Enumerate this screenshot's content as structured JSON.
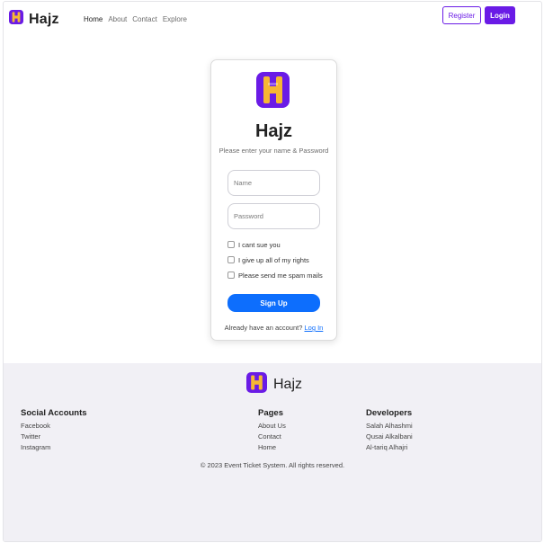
{
  "brand": {
    "name": "Hajz",
    "logo_icon": "hajz-logo-icon",
    "primary_color": "#6a1be6",
    "accent_color": "#f7b733"
  },
  "nav": {
    "links": [
      {
        "label": "Home"
      },
      {
        "label": "About"
      },
      {
        "label": "Contact"
      },
      {
        "label": "Explore"
      }
    ],
    "register_label": "Register",
    "login_label": "Login"
  },
  "signup": {
    "title": "Hajz",
    "subtitle": "Please enter your name & Password",
    "name_placeholder": "Name",
    "password_placeholder": "Password",
    "checkboxes": [
      {
        "label": "I cant sue you"
      },
      {
        "label": "I give up all of my rights"
      },
      {
        "label": "Please send me spam mails"
      }
    ],
    "submit_label": "Sign Up",
    "submit_color": "#0d6efd",
    "account_prompt": "Already have an account?",
    "login_link": "Log In"
  },
  "footer": {
    "brand": "Hajz",
    "columns": [
      {
        "title": "Social Accounts",
        "links": [
          "Facebook",
          "Twitter",
          "Instagram"
        ]
      },
      {
        "title": "Pages",
        "links": [
          "About Us",
          "Contact",
          "Home"
        ]
      },
      {
        "title": "Developers",
        "links": [
          "Salah Alhashmi",
          "Qusai Alkalbani",
          "Al-tariq Alhajri"
        ]
      }
    ],
    "copyright": "© 2023 Event Ticket System. All rights reserved."
  }
}
